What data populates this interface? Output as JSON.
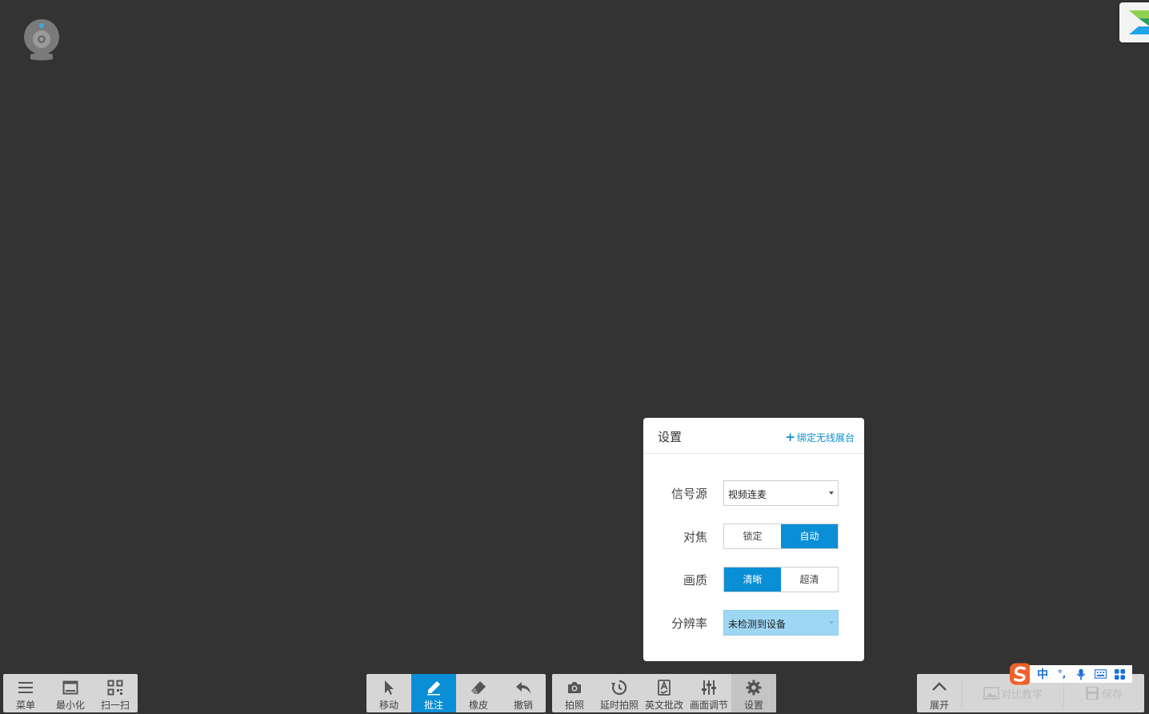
{
  "settings_panel": {
    "title": "设置",
    "bind_link": "绑定无线展台",
    "signal_source": {
      "label": "信号源",
      "value": "视频连麦"
    },
    "focus": {
      "label": "对焦",
      "options": [
        "锁定",
        "自动"
      ],
      "selected": "自动"
    },
    "quality": {
      "label": "画质",
      "options": [
        "清晰",
        "超清"
      ],
      "selected": "清晰"
    },
    "resolution": {
      "label": "分辨率",
      "value": "未检测到设备"
    }
  },
  "toolbar_left": [
    {
      "label": "菜单",
      "icon": "menu-icon"
    },
    {
      "label": "最小化",
      "icon": "minimize-icon"
    },
    {
      "label": "扫一扫",
      "icon": "qr-scan-icon"
    }
  ],
  "toolbar_annotate": [
    {
      "label": "移动",
      "icon": "pointer-icon"
    },
    {
      "label": "批注",
      "icon": "pen-icon",
      "active": true
    },
    {
      "label": "橡皮",
      "icon": "eraser-icon"
    },
    {
      "label": "撤销",
      "icon": "undo-icon"
    }
  ],
  "toolbar_capture": [
    {
      "label": "拍照",
      "icon": "camera-icon"
    },
    {
      "label": "延时拍照",
      "icon": "timer-history-icon"
    },
    {
      "label": "英文批改",
      "icon": "english-check-icon"
    },
    {
      "label": "画面调节",
      "icon": "sliders-icon"
    },
    {
      "label": "设置",
      "icon": "gear-icon",
      "pressed": true
    }
  ],
  "toolbar_right": {
    "expand": {
      "label": "展开",
      "icon": "chevron-up-icon"
    },
    "compare": {
      "label": "对比教学",
      "icon": "compare-image-icon"
    },
    "save": {
      "label": "保存",
      "icon": "save-icon"
    }
  },
  "ime": {
    "mode": "中",
    "punct": "°,"
  },
  "colors": {
    "background": "#333333",
    "accent": "#0a8fd6",
    "toolbar": "#d6d6d6",
    "disabled_select": "#9ed7f3"
  }
}
